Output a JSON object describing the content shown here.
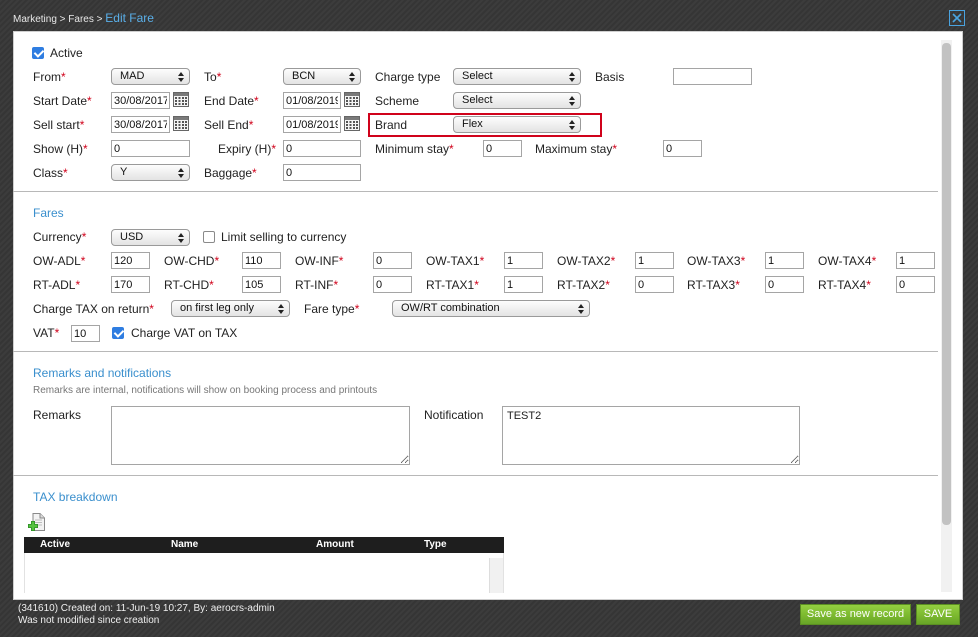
{
  "header": {
    "breadcrumb": "Marketing > Fares > ",
    "title": "Edit Fare"
  },
  "icons": {
    "close": "close-icon",
    "calendar": "calendar-icon",
    "select_arrows": "updown-arrows-icon",
    "add_tax": "add-document-icon"
  },
  "colors": {
    "accent": "#3a8fcd",
    "required": "#d0021b",
    "highlight_box": "#d0021b",
    "button": "#7cb92f",
    "checkbox": "#2f7de1"
  },
  "required_mark": "*",
  "general": {
    "active": {
      "label": "Active",
      "checked": true
    },
    "from": {
      "label": "From",
      "value": "MAD"
    },
    "to": {
      "label": "To",
      "value": "BCN"
    },
    "charge_type": {
      "label": "Charge type",
      "value": "Select"
    },
    "basis": {
      "label": "Basis",
      "value": ""
    },
    "start_date": {
      "label": "Start Date",
      "value": "30/08/2017"
    },
    "end_date": {
      "label": "End Date",
      "value": "01/08/2019"
    },
    "scheme": {
      "label": "Scheme",
      "value": "Select"
    },
    "sell_start": {
      "label": "Sell start",
      "value": "30/08/2017"
    },
    "sell_end": {
      "label": "Sell End",
      "value": "01/08/2019"
    },
    "brand": {
      "label": "Brand",
      "value": "Flex"
    },
    "show_h": {
      "label": "Show (H)",
      "value": "0"
    },
    "expiry_h": {
      "label": "Expiry (H)",
      "value": "0"
    },
    "minimum_stay": {
      "label": "Minimum stay",
      "value": "0"
    },
    "maximum_stay": {
      "label": "Maximum stay",
      "value": "0"
    },
    "class": {
      "label": "Class",
      "value": "Y"
    },
    "baggage": {
      "label": "Baggage",
      "value": "0"
    }
  },
  "fares": {
    "title": "Fares",
    "currency": {
      "label": "Currency",
      "value": "USD"
    },
    "limit_currency": {
      "label": "Limit selling to currency",
      "checked": false
    },
    "ow": [
      {
        "label": "OW-ADL",
        "value": "120"
      },
      {
        "label": "OW-CHD",
        "value": "110"
      },
      {
        "label": "OW-INF",
        "value": "0"
      },
      {
        "label": "OW-TAX1",
        "value": "1"
      },
      {
        "label": "OW-TAX2",
        "value": "1"
      },
      {
        "label": "OW-TAX3",
        "value": "1"
      },
      {
        "label": "OW-TAX4",
        "value": "1"
      }
    ],
    "rt": [
      {
        "label": "RT-ADL",
        "value": "170"
      },
      {
        "label": "RT-CHD",
        "value": "105"
      },
      {
        "label": "RT-INF",
        "value": "0"
      },
      {
        "label": "RT-TAX1",
        "value": "1"
      },
      {
        "label": "RT-TAX2",
        "value": "0"
      },
      {
        "label": "RT-TAX3",
        "value": "0"
      },
      {
        "label": "RT-TAX4",
        "value": "0"
      }
    ],
    "charge_tax_on_return": {
      "label": "Charge TAX on return",
      "value": "on first leg only"
    },
    "fare_type": {
      "label": "Fare type",
      "value": "OW/RT combination"
    },
    "vat": {
      "label": "VAT",
      "value": "10"
    },
    "charge_vat_on_tax": {
      "label": "Charge VAT on TAX",
      "checked": true
    }
  },
  "remarks": {
    "title": "Remarks and notifications",
    "subtitle": "Remarks are internal, notifications will show on booking process and printouts",
    "remarks": {
      "label": "Remarks",
      "value": ""
    },
    "notification": {
      "label": "Notification",
      "value": "TEST2"
    }
  },
  "tax_breakdown": {
    "title": "TAX breakdown",
    "columns": [
      "Active",
      "Name",
      "Amount",
      "Type"
    ],
    "rows": []
  },
  "footer": {
    "created": "(341610) Created on: 11-Jun-19 10:27, By: aerocrs-admin",
    "modified": "Was not modified since creation",
    "save_new_label": "Save as new record",
    "save_label": "SAVE"
  }
}
